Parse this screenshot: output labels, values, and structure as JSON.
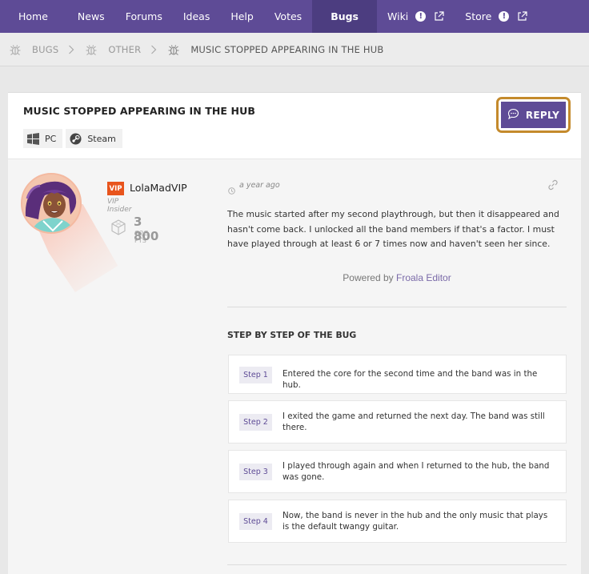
{
  "nav": {
    "items": [
      {
        "label": "Home"
      },
      {
        "label": "News"
      },
      {
        "label": "Forums"
      },
      {
        "label": "Ideas"
      },
      {
        "label": "Help"
      },
      {
        "label": "Votes"
      },
      {
        "label": "Bugs",
        "active": true
      },
      {
        "label": "Wiki",
        "badge": "!",
        "external": true
      },
      {
        "label": "Store",
        "badge": "!",
        "external": true
      }
    ]
  },
  "breadcrumb": {
    "items": [
      {
        "label": "BUGS",
        "icon": "bug-icon"
      },
      {
        "label": "OTHER",
        "icon": "bug-icon"
      },
      {
        "label": "MUSIC STOPPED APPEARING IN THE HUB",
        "icon": "bug-icon"
      }
    ]
  },
  "post": {
    "title": "MUSIC STOPPED APPEARING IN THE HUB",
    "tags": [
      {
        "label": "PC",
        "icon": "windows-icon"
      },
      {
        "label": "Steam",
        "icon": "steam-icon"
      }
    ],
    "reply_label": "REPLY",
    "time": "a year ago",
    "body": "The music started after my second playthrough, but then it disappeared and hasn't come back. I unlocked all the band members if that's a factor. I must have played through at least 6 or 7 times now and haven't seen her since.",
    "powered_prefix": "Powered by ",
    "powered_link": "Froala Editor"
  },
  "author": {
    "badge": "VIP",
    "name": "LolaMadVIP",
    "role": "VIP Insider",
    "points": "3 800",
    "points_label": "G2G PTS"
  },
  "steps": {
    "title": "STEP BY STEP OF THE BUG",
    "items": [
      {
        "num": "Step 1",
        "text": "Entered the core for the second time and the band was in the hub."
      },
      {
        "num": "Step 2",
        "text": "I exited the game and returned the next day. The band was still there."
      },
      {
        "num": "Step 3",
        "text": "I played through again and when I returned to the hub, the band was gone."
      },
      {
        "num": "Step 4",
        "text": "Now, the band is never in the hub and the only music that plays is the default twangy guitar."
      }
    ]
  },
  "colors": {
    "nav_bg": "#5e4b96",
    "nav_active": "#4c3d80",
    "reply_outline": "#c48a2c",
    "vip_badge": "#e8541c"
  }
}
